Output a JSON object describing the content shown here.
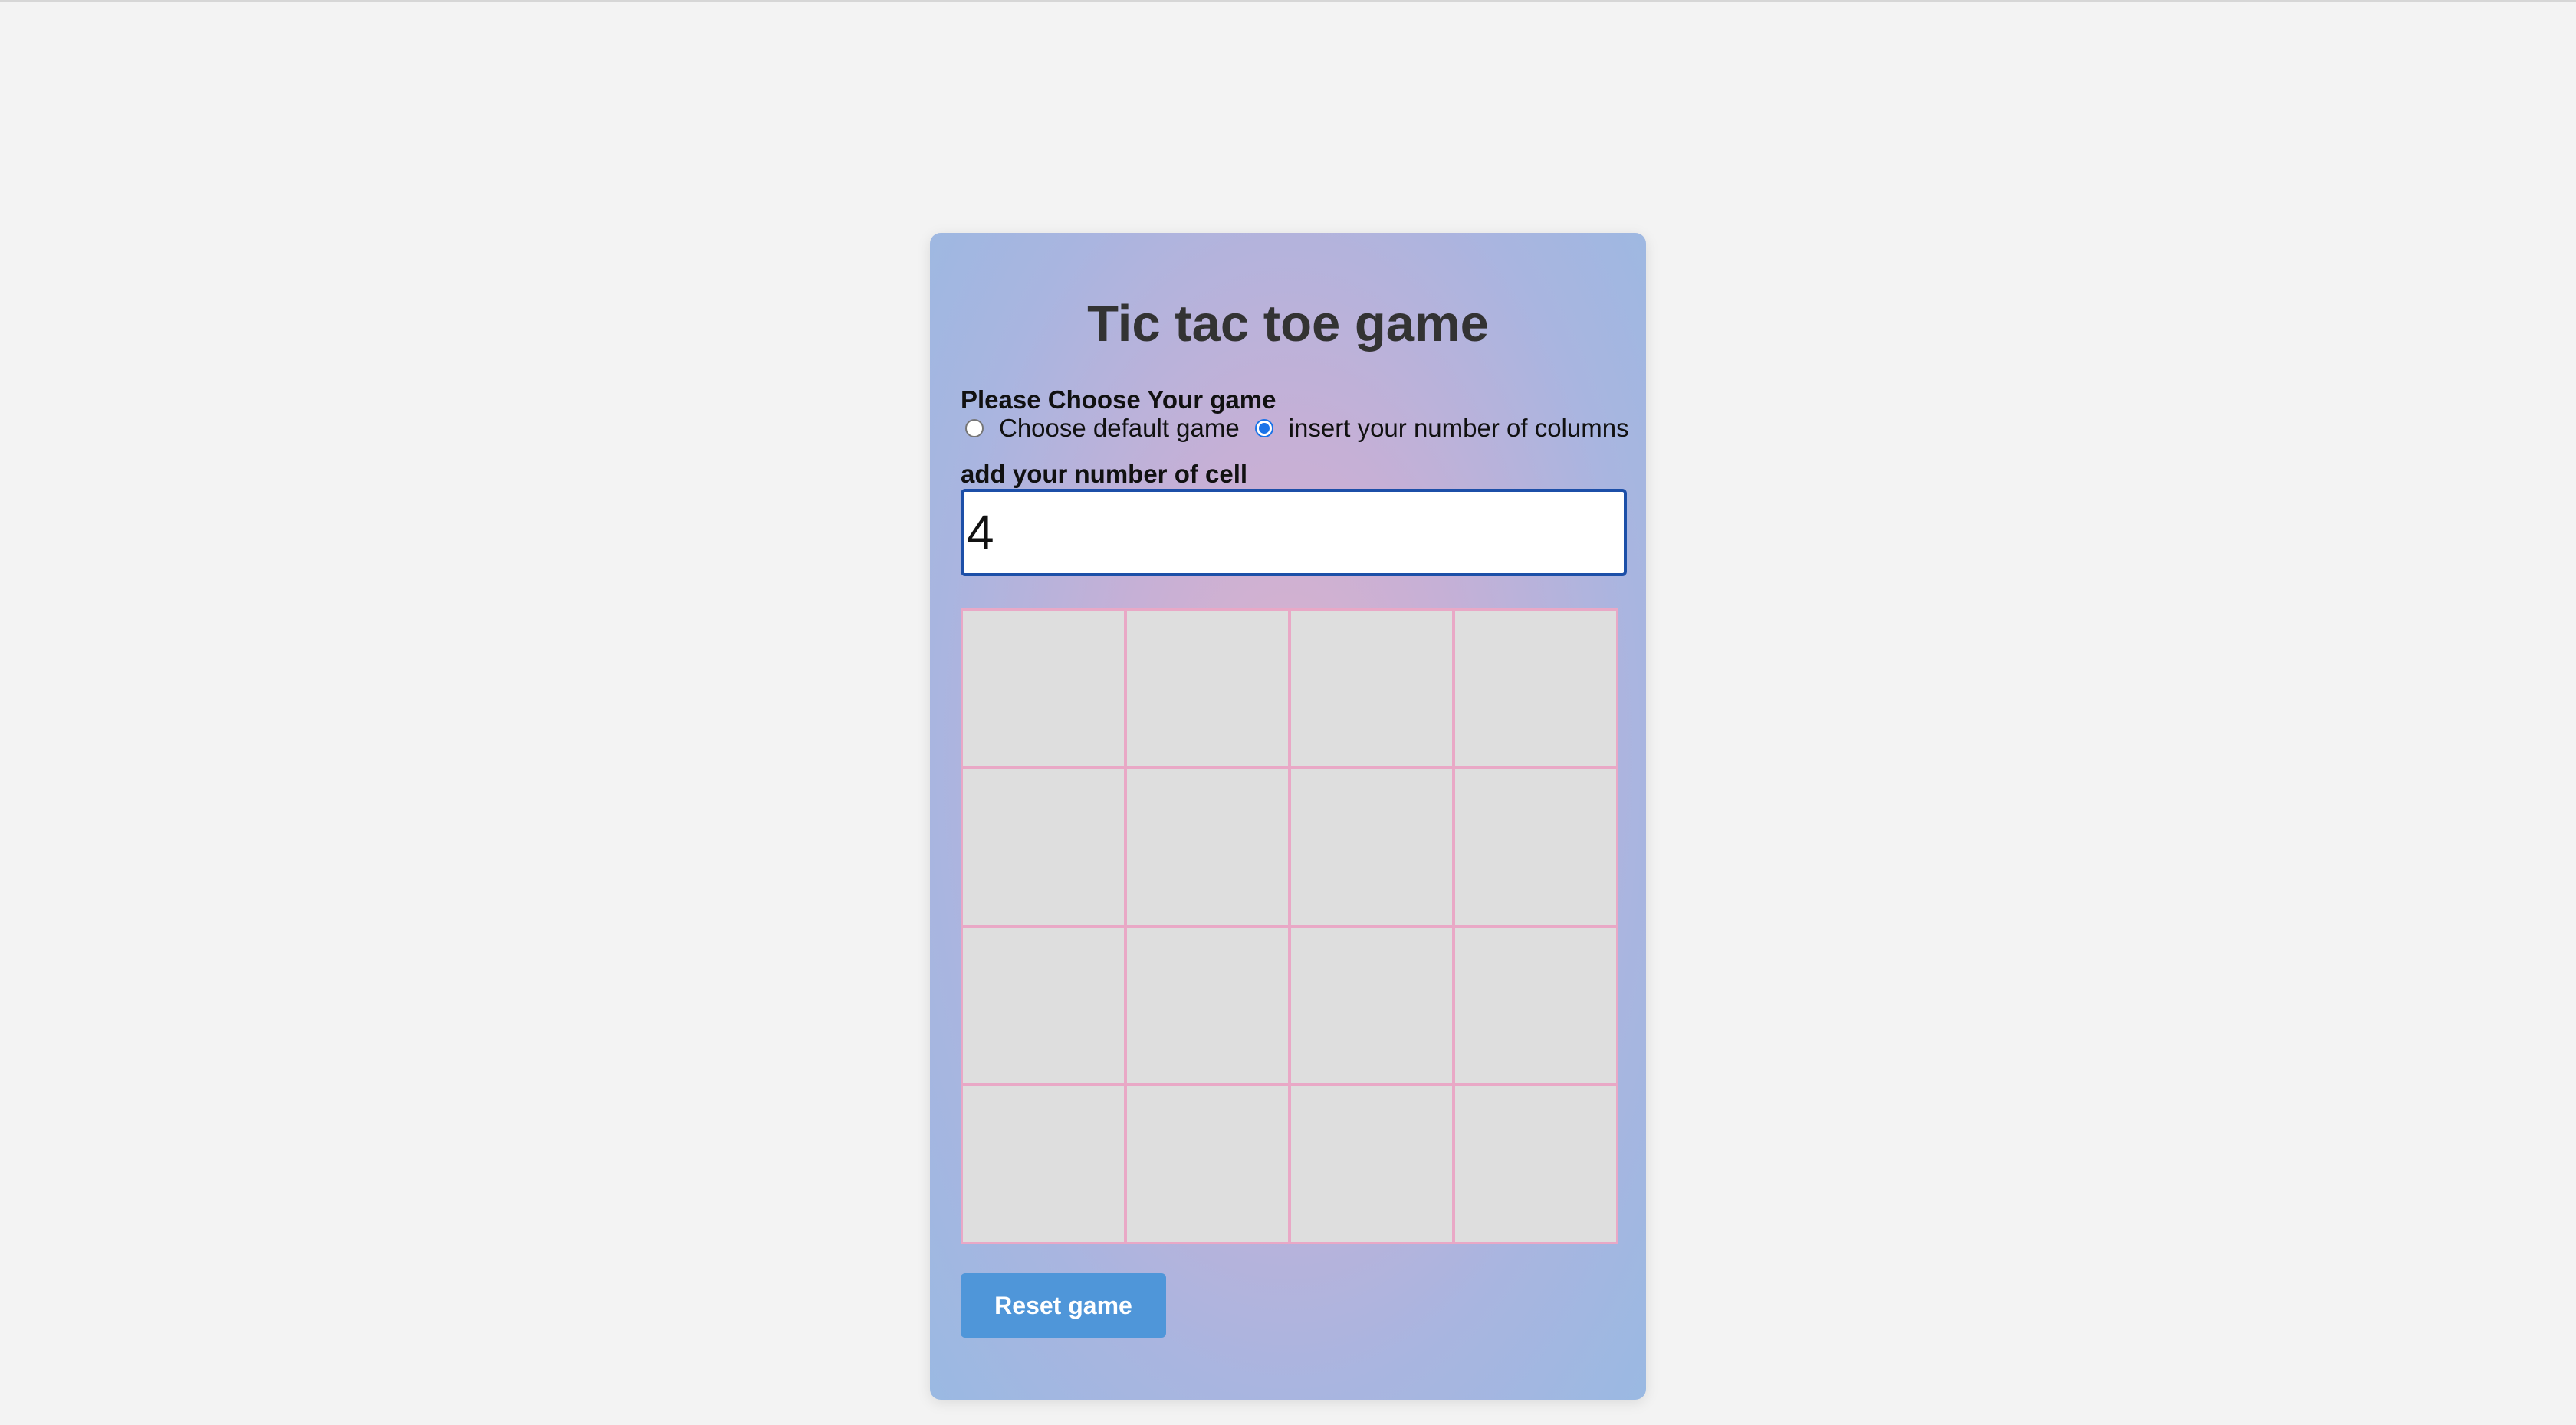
{
  "game": {
    "title": "Tic tac toe game",
    "choose_label": "Please Choose Your game",
    "options": [
      {
        "label": "Choose default game",
        "checked": false
      },
      {
        "label": "insert your number of columns",
        "checked": true
      }
    ],
    "cell_label": "add your number of cell",
    "cell_input_value": "4",
    "board": {
      "columns": 4,
      "rows": 4,
      "cells": [
        "",
        "",
        "",
        "",
        "",
        "",
        "",
        "",
        "",
        "",
        "",
        "",
        "",
        "",
        "",
        ""
      ]
    },
    "reset_label": "Reset game"
  },
  "colors": {
    "page_background": "#f3f3f3",
    "cell_background": "#dedede",
    "grid_lines": "#e9a8c6",
    "button": "#4f96d9",
    "radio_accent": "#1a73e8"
  }
}
